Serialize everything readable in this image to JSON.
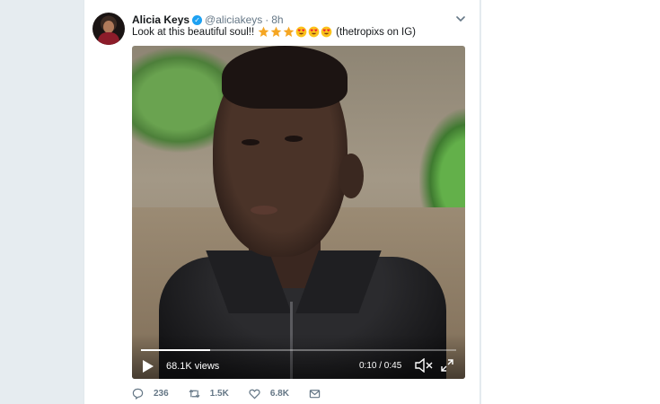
{
  "tweet": {
    "author_name": "Alicia Keys",
    "handle": "@aliciakeys",
    "separator": "·",
    "time": "8h",
    "text_prefix": "Look at this beautiful soul!!",
    "text_suffix": "(thetropixs on IG)",
    "emojis": [
      "star",
      "star",
      "star",
      "heart-eyes",
      "heart-eyes",
      "heart-eyes"
    ]
  },
  "video": {
    "views": "68.1K views",
    "timer": "0:10 / 0:45",
    "progress_fraction": 0.22
  },
  "actions": {
    "replies": "236",
    "retweets": "1.5K",
    "likes": "6.8K"
  },
  "colors": {
    "verified_badge": "#1da1f2",
    "secondary_text": "#657786",
    "page_background": "#e6ecf0"
  }
}
